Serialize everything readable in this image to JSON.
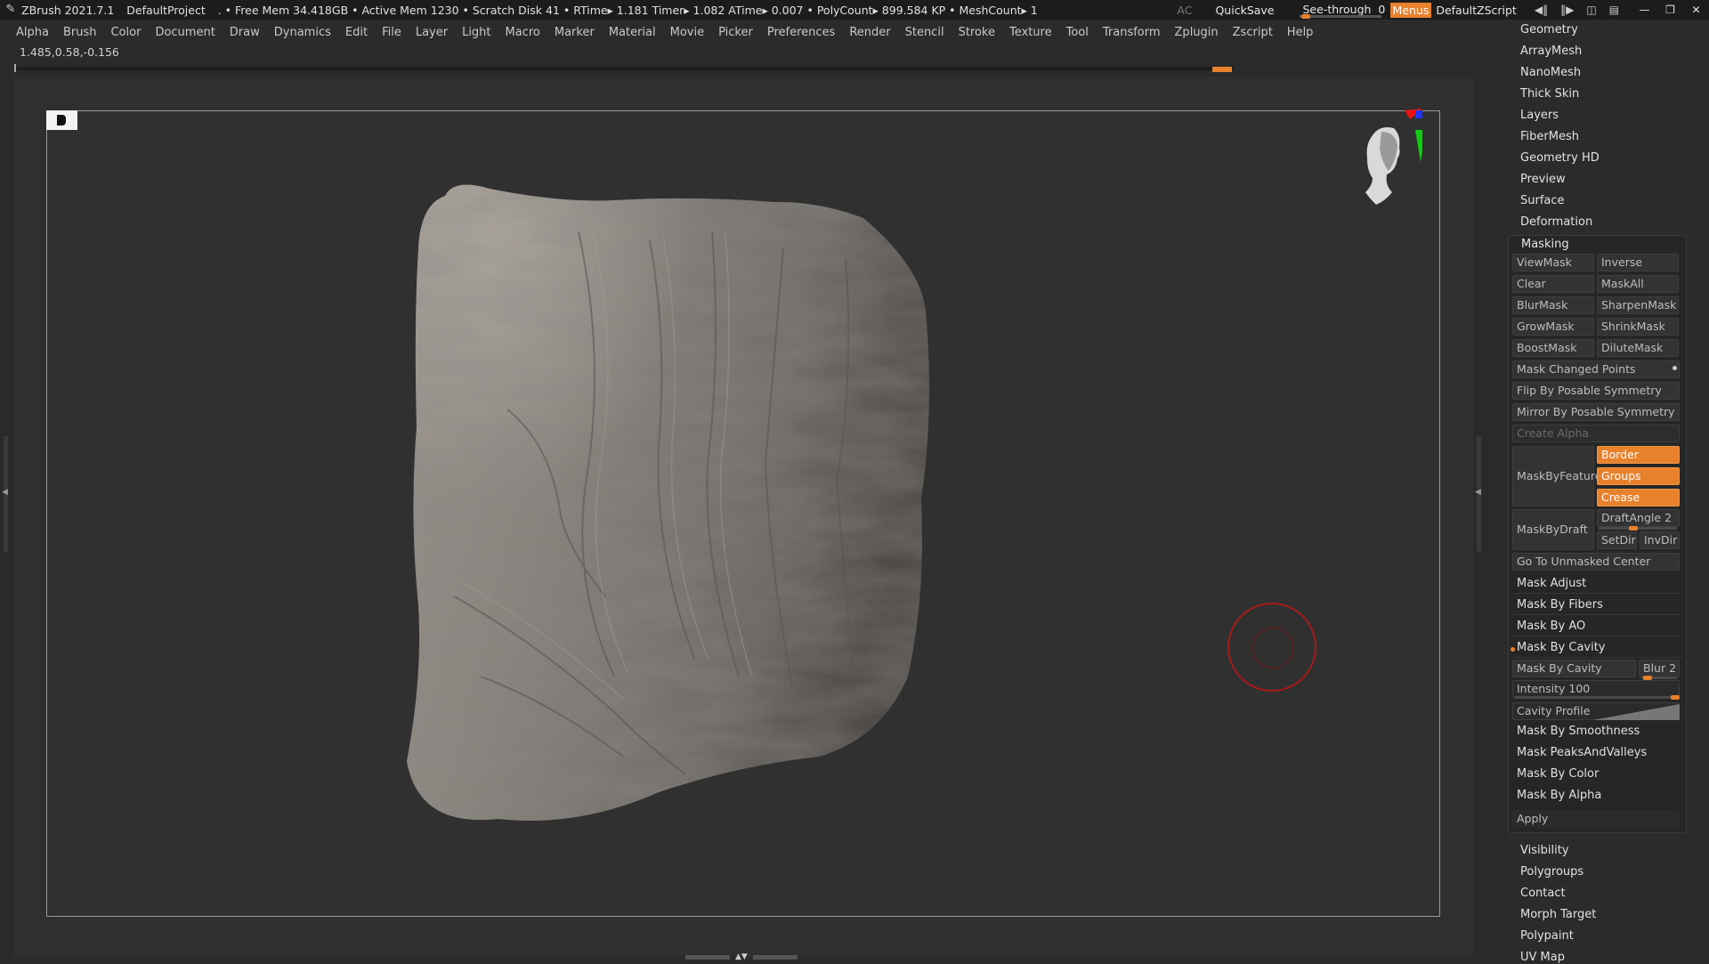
{
  "titlebar": {
    "app": "ZBrush 2021.7.1",
    "project": "DefaultProject",
    "stats": ". • Free Mem 34.418GB • Active Mem 1230 • Scratch Disk 41 •  RTime▸ 1.181 Timer▸ 1.082 ATime▸ 0.007 • PolyCount▸ 899.584 KP  • MeshCount▸ 1",
    "ac": "AC",
    "quicksave": "QuickSave",
    "see_through_label": "See-through",
    "see_through_value": "0",
    "menus": "Menus",
    "default_script": "DefaultZScript"
  },
  "menubar": [
    "Alpha",
    "Brush",
    "Color",
    "Document",
    "Draw",
    "Dynamics",
    "Edit",
    "File",
    "Layer",
    "Light",
    "Macro",
    "Marker",
    "Material",
    "Movie",
    "Picker",
    "Preferences",
    "Render",
    "Stencil",
    "Stroke",
    "Texture",
    "Tool",
    "Transform",
    "Zplugin",
    "Zscript",
    "Help"
  ],
  "coords": "1.485,0.58,-0.156",
  "tool_palette": {
    "top_items": [
      "Geometry",
      "ArrayMesh",
      "NanoMesh",
      "Thick Skin",
      "Layers",
      "FiberMesh",
      "Geometry HD",
      "Preview",
      "Surface",
      "Deformation"
    ],
    "masking": {
      "title": "Masking",
      "grid": [
        [
          "ViewMask",
          "Inverse"
        ],
        [
          "Clear",
          "MaskAll"
        ],
        [
          "BlurMask",
          "SharpenMask"
        ],
        [
          "GrowMask",
          "ShrinkMask"
        ],
        [
          "BoostMask",
          "DiluteMask"
        ]
      ],
      "mask_changed_points": "Mask Changed Points",
      "flip": "Flip By Posable Symmetry",
      "mirror": "Mirror By Posable Symmetry",
      "create_alpha": "Create Alpha",
      "mask_by_feature": "MaskByFeature",
      "border": "Border",
      "groups": "Groups",
      "crease": "Crease",
      "mask_by_draft": "MaskByDraft",
      "draft_angle_label": "DraftAngle",
      "draft_angle_value": "2",
      "set_dir": "SetDir",
      "inv_dir": "InvDir",
      "go_to_unmasked": "Go To Unmasked Center",
      "subs": [
        "Mask Adjust",
        "Mask By Fibers",
        "Mask By AO",
        "Mask By Cavity"
      ],
      "cavity_button": "Mask By Cavity",
      "blur_label": "Blur",
      "blur_value": "2",
      "intensity_label": "Intensity",
      "intensity_value": "100",
      "cavity_profile": "Cavity Profile",
      "more": [
        "Mask By Smoothness",
        "Mask PeaksAndValleys",
        "Mask By Color",
        "Mask By Alpha"
      ],
      "apply": "Apply"
    },
    "bottom_items": [
      "Visibility",
      "Polygroups",
      "Contact",
      "Morph Target",
      "Polypaint",
      "UV Map"
    ]
  },
  "colors": {
    "accent": "#e8812c",
    "cursor": "#a51a1a"
  }
}
